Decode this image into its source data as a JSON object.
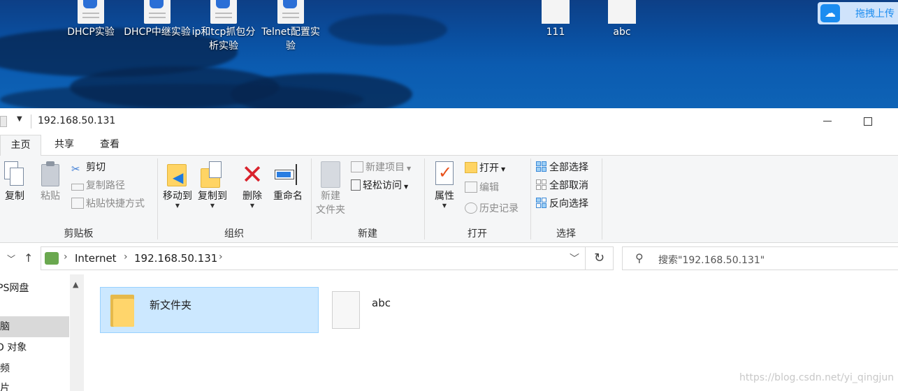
{
  "desktop": {
    "icons": [
      {
        "label": "DHCP实验"
      },
      {
        "label": "DHCP中继实验"
      },
      {
        "label": "ip和tcp抓包分析实验"
      },
      {
        "label": "Telnet配置实验"
      },
      {
        "label": "111"
      },
      {
        "label": "abc"
      }
    ],
    "baidu_upload": "拖拽上传"
  },
  "window": {
    "title": "192.168.50.131",
    "tabs": [
      "主页",
      "共享",
      "查看"
    ],
    "active_tab": "主页"
  },
  "ribbon": {
    "clipboard": {
      "group_label": "剪贴板",
      "copy": "复制",
      "paste": "粘贴",
      "cut": "剪切",
      "copy_path": "复制路径",
      "paste_shortcut": "粘贴快捷方式"
    },
    "organize": {
      "group_label": "组织",
      "move_to": "移动到",
      "copy_to": "复制到",
      "delete": "删除",
      "rename": "重命名"
    },
    "new": {
      "group_label": "新建",
      "new_folder_line1": "新建",
      "new_folder_line2": "文件夹",
      "new_item": "新建项目",
      "easy_access": "轻松访问"
    },
    "open": {
      "group_label": "打开",
      "properties": "属性",
      "open": "打开",
      "edit": "编辑",
      "history": "历史记录"
    },
    "select": {
      "group_label": "选择",
      "select_all": "全部选择",
      "select_none": "全部取消",
      "invert": "反向选择"
    }
  },
  "address": {
    "crumbs": [
      "Internet",
      "192.168.50.131"
    ],
    "search_placeholder": "搜索\"192.168.50.131\""
  },
  "nav_pane": {
    "items": [
      "PS网盘",
      "电脑",
      "D 对象",
      "视频",
      "图片"
    ],
    "selected": "电脑"
  },
  "files": [
    {
      "name": "新文件夹",
      "type": "folder",
      "selected": true
    },
    {
      "name": "abc",
      "type": "file",
      "selected": false
    }
  ],
  "watermark": "https://blog.csdn.net/yi_qingjun"
}
